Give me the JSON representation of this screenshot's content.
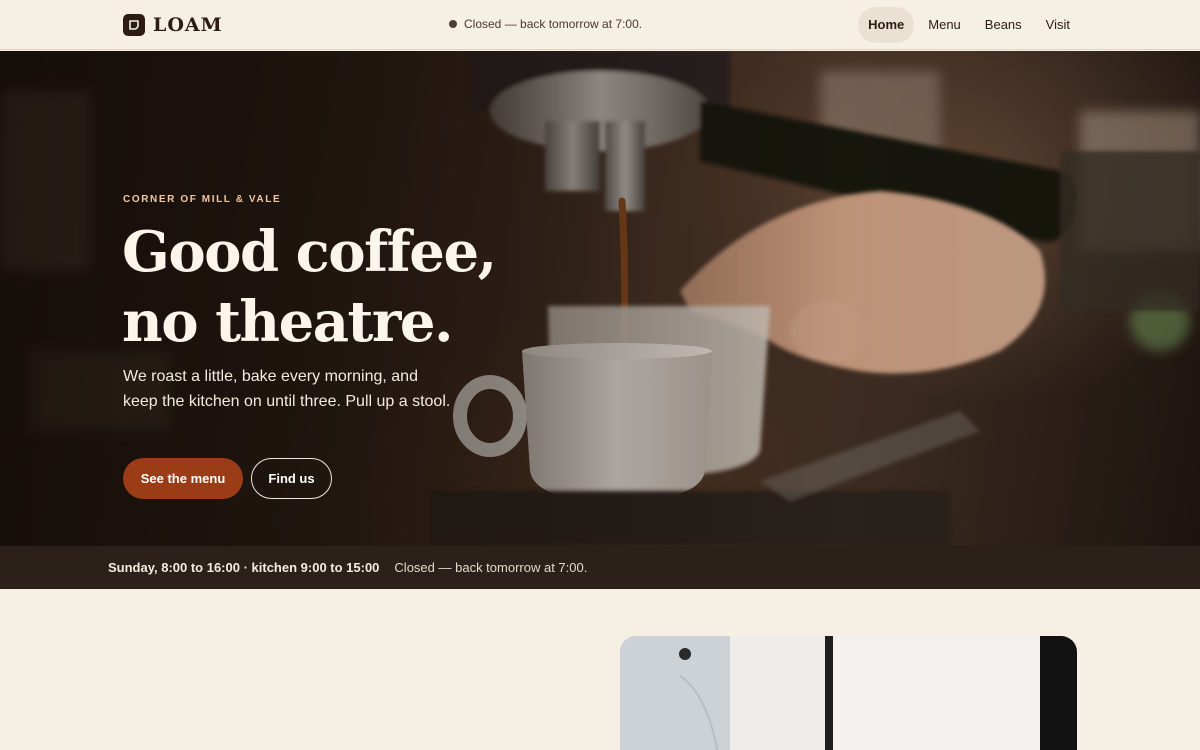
{
  "brand": {
    "name": "LOAM"
  },
  "status": {
    "text": "Closed — back tomorrow at 7:00."
  },
  "nav": {
    "items": [
      {
        "label": "Home",
        "active": true
      },
      {
        "label": "Menu",
        "active": false
      },
      {
        "label": "Beans",
        "active": false
      },
      {
        "label": "Visit",
        "active": false
      }
    ]
  },
  "hero": {
    "eyebrow": "CORNER OF MILL & VALE",
    "headline_line1": "Good coffee,",
    "headline_line2": "no theatre.",
    "lede": "We roast a little, bake every morning, and keep the kitchen on until three. Pull up a stool.",
    "primary_cta": "See the menu",
    "secondary_cta": "Find us",
    "image": "espresso-machine-pouring-into-white-cup"
  },
  "hours_band": {
    "hours": "Sunday, 8:00 to 16:00 · kitchen 9:00 to 15:00",
    "status": "Closed — back tomorrow at 7:00."
  },
  "story": {
    "image": "barista-in-white-shirt-and-dark-apron"
  },
  "colors": {
    "background": "#f6efe4",
    "ink": "#2b1d14",
    "accent": "#9a3d17",
    "eyebrow": "#f0c7a6",
    "band": "#2c201a"
  }
}
